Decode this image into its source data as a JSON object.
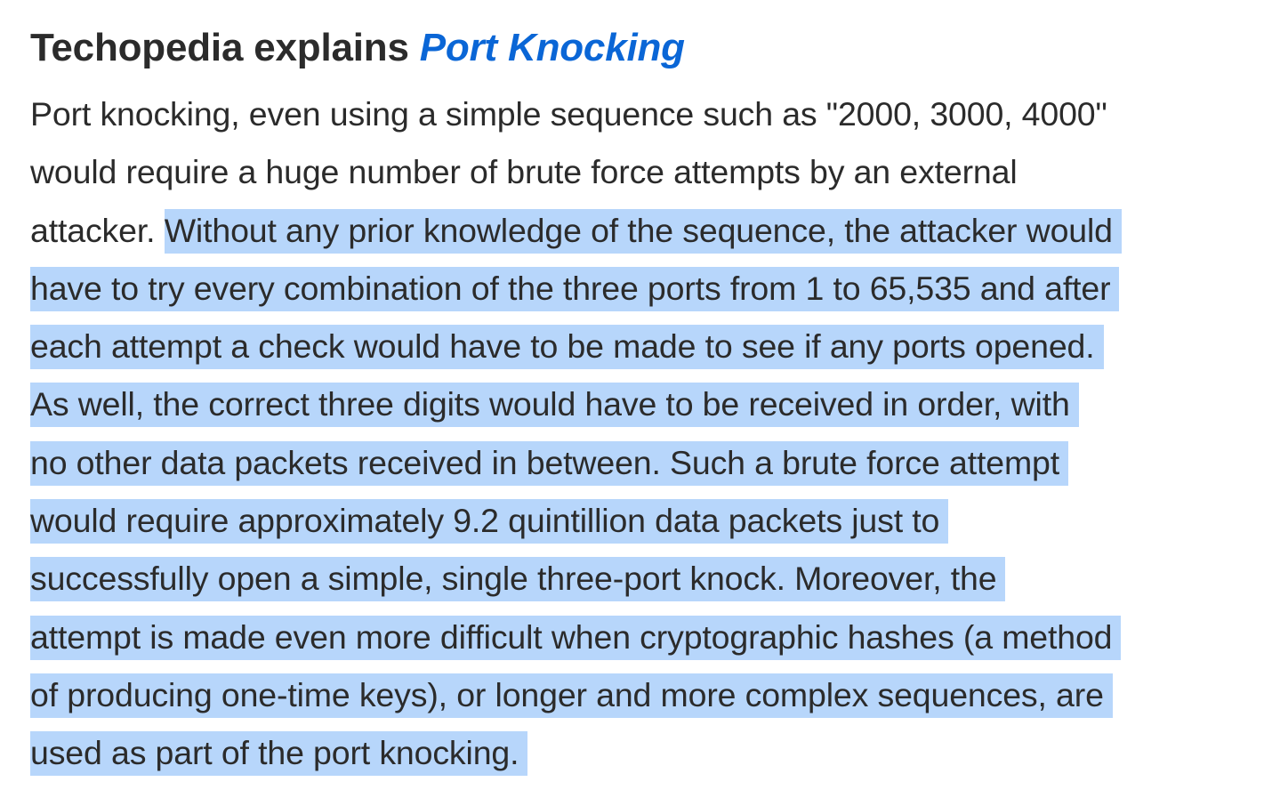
{
  "article": {
    "heading_prefix": "Techopedia explains",
    "heading_term": "Port Knocking",
    "lines": [
      {
        "plain": "Port knocking, even using a simple sequence such as \"2000, 3000, 4000\"",
        "selected": ""
      },
      {
        "plain": "would require a huge number of brute force attempts by an external",
        "selected": ""
      },
      {
        "plain": "attacker.",
        "selected": "Without any prior knowledge of the sequence, the attacker would"
      },
      {
        "plain": "",
        "selected": "have to try every combination of the three ports from 1 to 65,535 and after"
      },
      {
        "plain": "",
        "selected": "each attempt a check would have to be made to see if any ports opened."
      },
      {
        "plain": "",
        "selected": "As well, the correct three digits would have to be received in order, with"
      },
      {
        "plain": "",
        "selected": "no other data packets received in between. Such a brute force attempt"
      },
      {
        "plain": "",
        "selected": "would require approximately 9.2 quintillion data packets just to"
      },
      {
        "plain": "",
        "selected": "successfully open a simple, single three-port knock. Moreover, the"
      },
      {
        "plain": "",
        "selected": "attempt is made even more difficult when cryptographic hashes (a method"
      },
      {
        "plain": "",
        "selected": "of producing one-time keys), or longer and more complex sequences, are"
      },
      {
        "plain": "",
        "selected": "used as part of the port knocking."
      }
    ]
  },
  "colors": {
    "text": "#2b2b2b",
    "link": "#0a66d6",
    "selection": "#b7d6fb",
    "background": "#ffffff"
  }
}
